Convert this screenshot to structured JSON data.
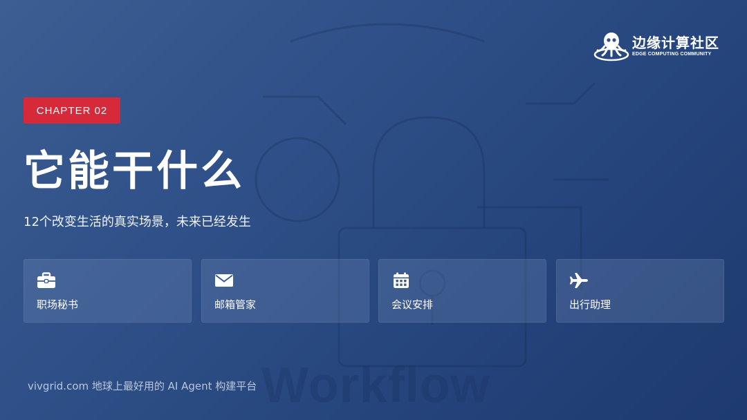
{
  "brand": {
    "name_cn": "边缘计算社区",
    "name_en": "EDGE COMPUTING COMMUNITY",
    "logo_icon": "octopus-icon"
  },
  "chapter": {
    "badge": "CHAPTER 02",
    "title": "它能干什么",
    "subtitle": "12个改变生活的真实场景，未来已经发生"
  },
  "cards": [
    {
      "label": "职场秘书",
      "icon": "briefcase-icon"
    },
    {
      "label": "邮箱管家",
      "icon": "envelope-icon"
    },
    {
      "label": "会议安排",
      "icon": "calendar-icon"
    },
    {
      "label": "出行助理",
      "icon": "airplane-icon"
    }
  ],
  "footer": {
    "text": "vivgrid.com 地球上最好用的 AI Agent 构建平台"
  },
  "watermark": "Workflow",
  "colors": {
    "accent_red": "#d62a3a",
    "background_top": "#3c5e92",
    "background_bottom": "#1e3a6e",
    "text": "#ffffff"
  }
}
